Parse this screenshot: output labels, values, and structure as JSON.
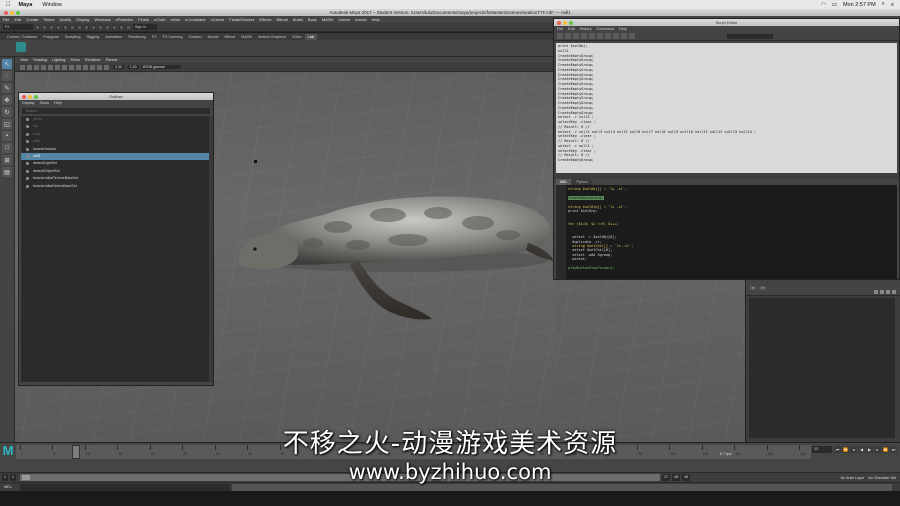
{
  "mac_menubar": {
    "app": "Maya",
    "items": [
      "Window"
    ],
    "clock": "Mon 2:57 PM"
  },
  "window_title": "Autodesk Maya 2017 – Student Version: /Users/lulu/Documents/maya/projects/fxMasters/scenes/sealionTTF.mb* --- null1",
  "maya_menu": [
    "File",
    "Edit",
    "Create",
    "Select",
    "Modify",
    "Display",
    "Windows",
    "nParticles",
    "Fluids",
    "nCloth",
    "nHair",
    "nConstraint",
    "nCache",
    "Fields/Solvers",
    "Effects",
    "Bifrost",
    "Bullet",
    "Boss",
    "MASH",
    "Cache",
    "Arnold",
    "Help"
  ],
  "status_line": {
    "mode": "FX",
    "sign_in": "Sign In"
  },
  "shelf_tabs": [
    "Curves / Surfaces",
    "Polygons",
    "Sculpting",
    "Rigging",
    "Animation",
    "Rendering",
    "FX",
    "FX Caching",
    "Custom",
    "Arnold",
    "Bifrost",
    "MASH",
    "Motion Graphics",
    "XGen",
    "Lab"
  ],
  "shelf_tabs_active": 14,
  "panel_menu": [
    "View",
    "Shading",
    "Lighting",
    "Show",
    "Renderer",
    "Panels"
  ],
  "panel_tools": {
    "near_value": "0.00",
    "far_value": "1.00",
    "color_space": "sRGB gamma"
  },
  "outliner": {
    "title": "Outliner",
    "menu": [
      "Display",
      "Show",
      "Help"
    ],
    "search_placeholder": "Search...",
    "rows": [
      {
        "label": "persp",
        "state": "dim"
      },
      {
        "label": "top",
        "state": "dim"
      },
      {
        "label": "front",
        "state": "dim"
      },
      {
        "label": "side",
        "state": "dim"
      },
      {
        "label": "furseal:furseal",
        "state": "normal"
      },
      {
        "label": "null1",
        "state": "sel"
      },
      {
        "label": "defaultLightSet",
        "state": "normal"
      },
      {
        "label": "defaultObjectSet",
        "state": "normal"
      },
      {
        "label": "furseal:initialTextureBakeSet",
        "state": "normal"
      },
      {
        "label": "furseal:initialVertexBakeSet",
        "state": "normal"
      }
    ]
  },
  "script_editor": {
    "title": "Script Editor",
    "menu": [
      "File",
      "Edit",
      "History",
      "Command",
      "Help"
    ],
    "history": [
      "print $selObj;",
      "null1",
      "CreateEmptyGroup;",
      "CreateEmptyGroup;",
      "CreateEmptyGroup;",
      "CreateEmptyGroup;",
      "CreateEmptyGroup;",
      "CreateEmptyGroup;",
      "CreateEmptyGroup;",
      "CreateEmptyGroup;",
      "CreateEmptyGroup;",
      "CreateEmptyGroup;",
      "CreateEmptyGroup;",
      "CreateEmptyGroup;",
      "CreateEmptyGroup;",
      "select -r null2 ;",
      "selectKey -clear ;",
      "// Result: 0 //",
      "select -r null2 null3 null4 null5 null6 null7 null8 null9 null10 null11 null12 null13 null14 ;",
      "selectKey -clear ;",
      "// Result: 0 //",
      "select -r null1 ;",
      "selectKey -clear ;",
      "// Result: 0 //",
      "CreateEmptyGroup;"
    ],
    "tabs": [
      "MEL",
      "Python"
    ],
    "active_tab": 0,
    "input_lines": [
      {
        "text": "string $selObj[] = `ls -sl`;",
        "cls": "kw"
      },
      {
        "text": "",
        "cls": "tx"
      },
      {
        "text": "CreateEmptyGroup;",
        "cls": "hl"
      },
      {
        "text": "",
        "cls": "tx"
      },
      {
        "text": "string $selGrp[] = `ls -sl`;",
        "cls": "kw"
      },
      {
        "text": "print $selGrp;",
        "cls": "tx"
      },
      {
        "text": "",
        "cls": "tx"
      },
      {
        "text": "",
        "cls": "tx"
      },
      {
        "text": "for ($i=0; $i <=9; $i++)",
        "cls": "kw"
      },
      {
        "text": "",
        "cls": "tx"
      },
      {
        "text": "",
        "cls": "tx"
      },
      {
        "text": "  select -r $selObj[0];",
        "cls": "tx"
      },
      {
        "text": "  duplicate -rr;",
        "cls": "tx"
      },
      {
        "text": "  string $selChil[] = `ls -sl`;",
        "cls": "kw"
      },
      {
        "text": "  select $selChil[0];",
        "cls": "tx"
      },
      {
        "text": "  select -add $group;",
        "cls": "tx"
      },
      {
        "text": "  parent;",
        "cls": "tx"
      },
      {
        "text": "",
        "cls": "tx"
      },
      {
        "text": "playButtonStepForward;",
        "cls": "cm"
      }
    ]
  },
  "timeline": {
    "ticks": [
      "1",
      "5",
      "10",
      "15",
      "20",
      "25",
      "30",
      "35",
      "40",
      "45",
      "50",
      "55",
      "60",
      "65",
      "70",
      "75",
      "80",
      "85",
      "90",
      "95",
      "100",
      "105",
      "110",
      "115",
      "120"
    ],
    "current_frame": "13",
    "fps": "6.7 fps",
    "frame_field": "13"
  },
  "range_slider": {
    "start": "1",
    "start_inner": "1",
    "end_inner": "17",
    "end": "48",
    "end_outer": "48",
    "anim_layer": "No Anim Layer",
    "char_set": "No Character Set"
  },
  "command_line": {
    "lang": "MEL"
  },
  "watermark": {
    "line1": "不移之火-动漫游戏美术资源",
    "line2": "www.byzhihuo.com"
  },
  "colors": {
    "selection": "#5285a6",
    "maya_logo": "#2fb6c7"
  }
}
